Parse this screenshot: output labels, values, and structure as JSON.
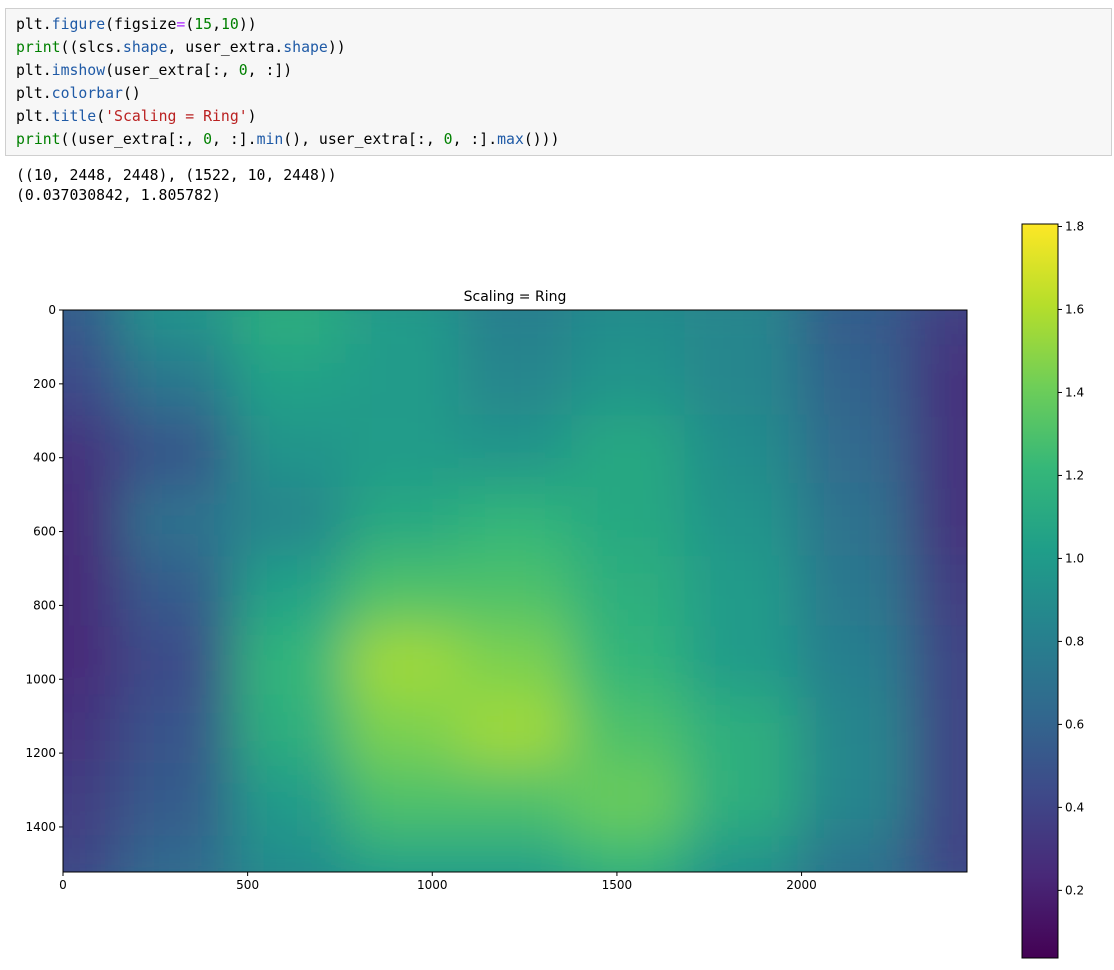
{
  "code_cell": {
    "lines": [
      [
        {
          "t": "plt",
          "c": "default"
        },
        {
          "t": ".",
          "c": "default"
        },
        {
          "t": "figure",
          "c": "attr"
        },
        {
          "t": "(figsize",
          "c": "default"
        },
        {
          "t": "=",
          "c": "op"
        },
        {
          "t": "(",
          "c": "default"
        },
        {
          "t": "15",
          "c": "number"
        },
        {
          "t": ",",
          "c": "default"
        },
        {
          "t": "10",
          "c": "number"
        },
        {
          "t": "))",
          "c": "default"
        }
      ],
      [
        {
          "t": "print",
          "c": "builtin"
        },
        {
          "t": "((slcs.",
          "c": "default"
        },
        {
          "t": "shape",
          "c": "attr"
        },
        {
          "t": ", user_extra.",
          "c": "default"
        },
        {
          "t": "shape",
          "c": "attr"
        },
        {
          "t": "))",
          "c": "default"
        }
      ],
      [
        {
          "t": "plt",
          "c": "default"
        },
        {
          "t": ".",
          "c": "default"
        },
        {
          "t": "imshow",
          "c": "attr"
        },
        {
          "t": "(user_extra[:, ",
          "c": "default"
        },
        {
          "t": "0",
          "c": "number"
        },
        {
          "t": ", :])",
          "c": "default"
        }
      ],
      [
        {
          "t": "plt",
          "c": "default"
        },
        {
          "t": ".",
          "c": "default"
        },
        {
          "t": "colorbar",
          "c": "attr"
        },
        {
          "t": "()",
          "c": "default"
        }
      ],
      [
        {
          "t": "plt",
          "c": "default"
        },
        {
          "t": ".",
          "c": "default"
        },
        {
          "t": "title",
          "c": "attr"
        },
        {
          "t": "(",
          "c": "default"
        },
        {
          "t": "'Scaling = Ring'",
          "c": "string"
        },
        {
          "t": ")",
          "c": "default"
        }
      ],
      [
        {
          "t": "print",
          "c": "builtin"
        },
        {
          "t": "((user_extra[:, ",
          "c": "default"
        },
        {
          "t": "0",
          "c": "number"
        },
        {
          "t": ", :].",
          "c": "default"
        },
        {
          "t": "min",
          "c": "attr"
        },
        {
          "t": "(), user_extra[:, ",
          "c": "default"
        },
        {
          "t": "0",
          "c": "number"
        },
        {
          "t": ", :].",
          "c": "default"
        },
        {
          "t": "max",
          "c": "attr"
        },
        {
          "t": "()))",
          "c": "default"
        }
      ]
    ]
  },
  "output": {
    "lines": [
      "((10, 2448, 2448), (1522, 10, 2448))",
      "(0.037030842, 1.805782)"
    ]
  },
  "plot": {
    "title": "Scaling = Ring",
    "x_ticks": [
      "0",
      "500",
      "1000",
      "1500",
      "2000"
    ],
    "y_ticks": [
      "0",
      "200",
      "400",
      "600",
      "800",
      "1000",
      "1200",
      "1400"
    ],
    "colorbar_ticks": [
      "1.8",
      "1.6",
      "1.4",
      "1.2",
      "1.0",
      "0.8",
      "0.6",
      "0.4",
      "0.2"
    ],
    "colormap": [
      "#440154",
      "#482878",
      "#3e4989",
      "#31688e",
      "#26828e",
      "#1f9e89",
      "#35b779",
      "#6ece58",
      "#b5de2b",
      "#fde725"
    ]
  },
  "chart_data": {
    "type": "heatmap",
    "title": "Scaling = Ring",
    "xlabel": "",
    "ylabel": "",
    "xlim": [
      0,
      2448
    ],
    "ylim": [
      1522,
      0
    ],
    "x_ticks": [
      0,
      500,
      1000,
      1500,
      2000
    ],
    "y_ticks": [
      0,
      200,
      400,
      600,
      800,
      1000,
      1200,
      1400
    ],
    "colorbar": {
      "range": [
        0.037,
        1.806
      ],
      "ticks": [
        0.2,
        0.4,
        0.6,
        0.8,
        1.0,
        1.2,
        1.4,
        1.6,
        1.8
      ],
      "colormap": "viridis"
    },
    "grid_columns": [
      0,
      306,
      612,
      918,
      1224,
      1530,
      1836,
      2142,
      2448
    ],
    "grid_rows": [
      0,
      190,
      380,
      571,
      761,
      951,
      1141,
      1332,
      1522
    ],
    "values": [
      [
        0.55,
        0.95,
        1.15,
        1.0,
        0.8,
        0.9,
        0.85,
        0.55,
        0.35
      ],
      [
        0.45,
        0.75,
        1.05,
        1.0,
        0.85,
        0.95,
        0.85,
        0.6,
        0.3
      ],
      [
        0.3,
        0.5,
        0.95,
        1.0,
        0.95,
        1.1,
        0.9,
        0.65,
        0.3
      ],
      [
        0.25,
        0.7,
        0.85,
        1.1,
        1.2,
        1.1,
        0.95,
        0.7,
        0.3
      ],
      [
        0.25,
        0.55,
        1.05,
        1.3,
        1.3,
        1.15,
        1.0,
        0.75,
        0.35
      ],
      [
        0.25,
        0.45,
        1.2,
        1.55,
        1.45,
        1.2,
        1.0,
        0.8,
        0.4
      ],
      [
        0.3,
        0.5,
        1.15,
        1.45,
        1.55,
        1.3,
        1.15,
        0.85,
        0.4
      ],
      [
        0.35,
        0.55,
        1.0,
        1.3,
        1.3,
        1.4,
        1.15,
        0.85,
        0.4
      ],
      [
        0.4,
        0.65,
        0.9,
        1.05,
        1.05,
        1.2,
        0.95,
        0.7,
        0.4
      ]
    ]
  }
}
